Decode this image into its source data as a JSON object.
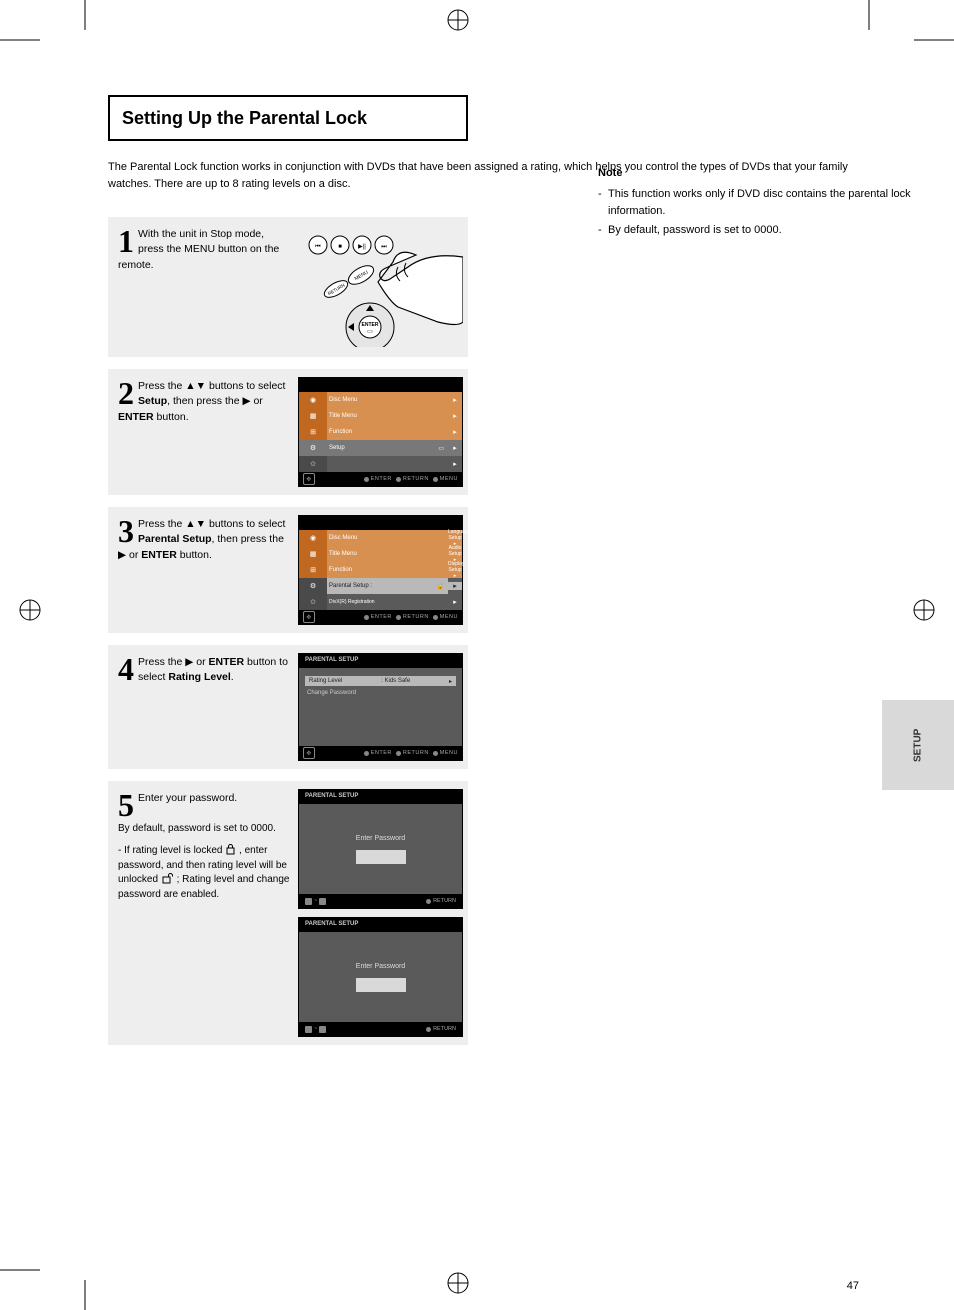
{
  "heading": "Setting Up the Parental Lock",
  "intro": [
    "The Parental Lock function works in conjunction with DVDs that have been assigned a rating, which helps you control the types of DVDs that your family watches. There are up to 8 rating levels on a disc."
  ],
  "steps": [
    {
      "num": "1",
      "text": "With the unit in Stop mode, press the MENU button on the remote."
    },
    {
      "num": "2",
      "text_parts": [
        "Press the ",
        "▲▼",
        " buttons to select ",
        "Setup",
        ", then press the ",
        "▶",
        " or ",
        "ENTER",
        " button."
      ]
    },
    {
      "num": "3",
      "text_parts": [
        "Press the ",
        "▲▼",
        " buttons to select ",
        "Parental Setup",
        ", then press the ",
        "▶",
        " or ",
        "ENTER",
        " button."
      ]
    },
    {
      "num": "4",
      "text_parts": [
        "Press the ",
        "▶",
        " or ",
        "ENTER",
        " button to select ",
        "Rating Level",
        "."
      ]
    },
    {
      "num": "5",
      "text": "Enter your password.",
      "sub": "By default, password is set to 0000.",
      "extra": [
        "- If rating level is locked ",
        " , enter password, and then rating level will be unlocked ",
        " ; Rating level and change password are enabled."
      ]
    }
  ],
  "screens": {
    "main_menu": {
      "title_left": "",
      "title_right": "",
      "rows": [
        {
          "label": "Disc Menu"
        },
        {
          "label": "Title Menu"
        },
        {
          "label": "Function"
        },
        {
          "label": ""
        }
      ],
      "footer": [
        "ENTER",
        "RETURN",
        "MENU"
      ]
    },
    "setup_menu": {
      "rows": [
        {
          "label": "Disc Menu"
        },
        {
          "label": "Title Menu"
        },
        {
          "label": "Function"
        },
        {
          "label": ""
        }
      ],
      "submenu": [
        {
          "label": "Language Setup"
        },
        {
          "label": "Audio Setup"
        },
        {
          "label": "Display Setup"
        },
        {
          "label": "Parental Setup :",
          "highlight": true
        },
        {
          "label": "DivX(R) Registration"
        }
      ]
    },
    "parental_setup": {
      "title": "PARENTAL SETUP",
      "rows": [
        {
          "label": "Rating Level",
          "value": ": Kids Safe",
          "highlight": true
        },
        {
          "label": "Change Password"
        }
      ]
    },
    "password1": {
      "title": "PARENTAL SETUP",
      "prompt": "Enter Password",
      "footer_left": "0~9",
      "footer_right": "RETURN"
    },
    "password2": {
      "title": "PARENTAL SETUP",
      "prompt": "Enter Password",
      "footer_left": "0~9",
      "footer_right": "RETURN"
    }
  },
  "note": {
    "head": "Note",
    "items": [
      "This function works only if DVD disc contains the parental lock information.",
      "By default, password is set to 0000."
    ]
  },
  "side_tab": "SETUP",
  "page_num_left": "",
  "page_num_right": "47",
  "footer_dots": {
    "enter": "ENTER",
    "return": "RETURN",
    "menu": "MENU"
  }
}
